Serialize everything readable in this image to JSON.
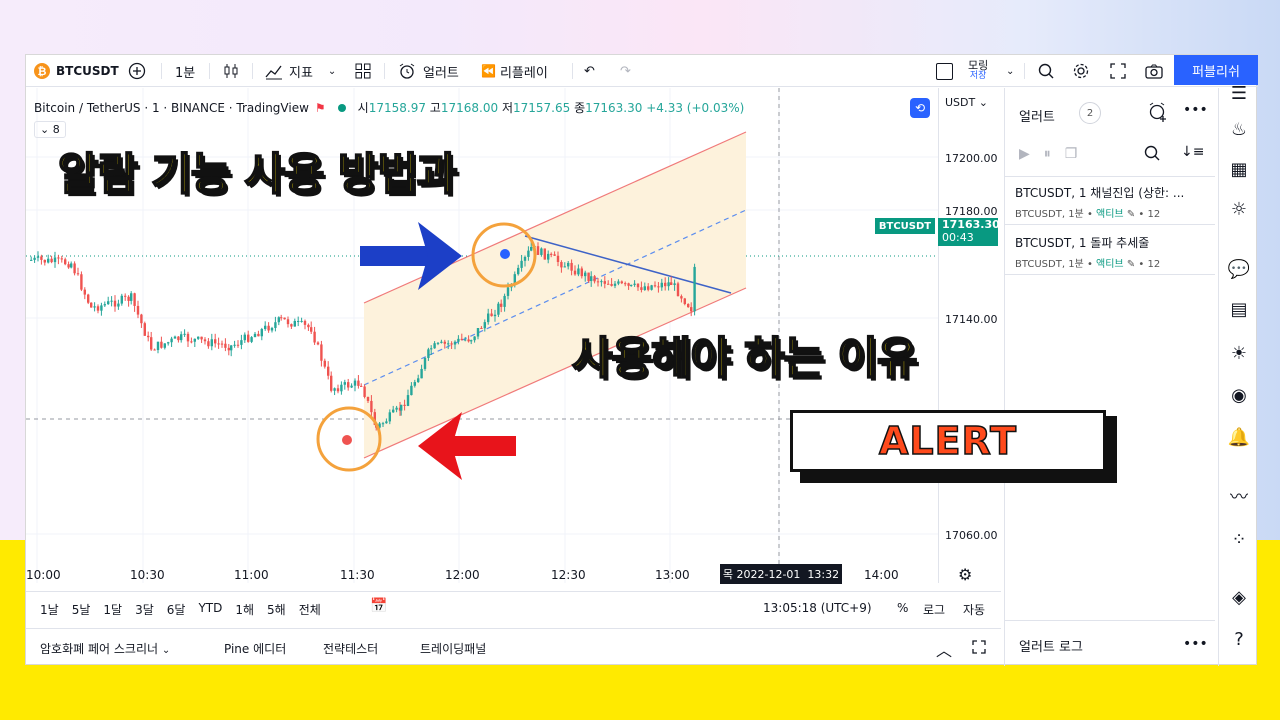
{
  "toolbar": {
    "symbol": "BTCUSDT",
    "interval": "1분",
    "indicators": "지표",
    "alert": "얼러트",
    "replay": "리플레이",
    "save_top": "모링",
    "save_bottom": "저장",
    "publish": "퍼블리쉬"
  },
  "legend": {
    "title": "Bitcoin / TetherUS · 1 · BINANCE · TradingView",
    "o_k": "시",
    "o": "17158.97",
    "h_k": "고",
    "h": "17168.00",
    "l_k": "저",
    "l": "17157.65",
    "c_k": "종",
    "c": "17163.30",
    "chg": "+4.33 (+0.03%)",
    "vol_toggle": "8"
  },
  "price_axis": {
    "currency": "USDT",
    "labels": [
      "17200.00",
      "17180.00",
      "17140.00",
      "17060.00"
    ],
    "symbol_tag": "BTCUSDT",
    "last_price": "17163.30",
    "countdown": "00:43"
  },
  "time_axis": {
    "labels": [
      "10:00",
      "10:30",
      "11:00",
      "11:30",
      "12:00",
      "12:30",
      "13:00",
      "14:00"
    ],
    "cursor": "목 2022-12-01  13:32"
  },
  "range_bar": {
    "ranges": [
      "1날",
      "5날",
      "1달",
      "3달",
      "6달",
      "YTD",
      "1해",
      "5해",
      "전체"
    ],
    "clock": "13:05:18 (UTC+9)",
    "pct": "%",
    "log": "로그",
    "auto": "자동"
  },
  "bottom_tabs": [
    "암호화폐 페어 스크리너",
    "Pine 에디터",
    "전략테스터",
    "트레이딩패널"
  ],
  "alerts_panel": {
    "title": "얼러트",
    "count": "2",
    "items": [
      {
        "name": "BTCUSDT, 1 채널진입 (상한: ...",
        "sub": "BTCUSDT, 1분 •",
        "status": "액티브",
        "tail": "• 12"
      },
      {
        "name": "BTCUSDT, 1 돌파 추세줄",
        "sub": "BTCUSDT, 1분 •",
        "status": "액티브",
        "tail": "• 12"
      }
    ],
    "log_title": "얼러트 로그"
  },
  "overlay": {
    "title_line1": "알람 기능 사용 방법과",
    "title_line2": "사용해야 하는 이유",
    "badge": "ALERT"
  },
  "colors": {
    "up": "#26a69a",
    "down": "#ef5350",
    "accent": "#2962ff",
    "channel_fill": "#fdf2dc",
    "channel_line": "#f07a7a",
    "circle": "#f4a23c"
  }
}
